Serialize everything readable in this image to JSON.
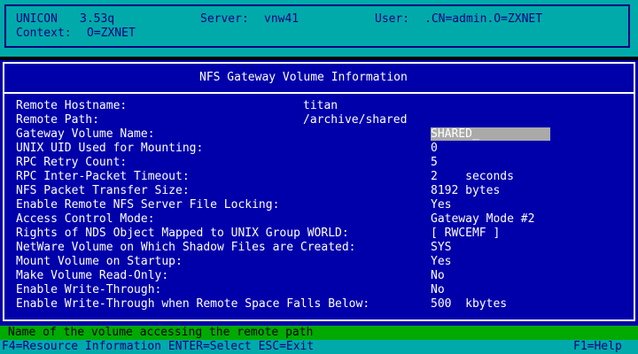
{
  "header": {
    "app_name": "UNICON",
    "version": "3.53q",
    "server_label": "Server:",
    "server_value": "vnw41",
    "user_label": "User:",
    "user_value": ".CN=admin.O=ZXNET",
    "context_label": "Context:",
    "context_value": "O=ZXNET"
  },
  "panel": {
    "title": "NFS Gateway Volume Information",
    "fields": [
      {
        "label": "Remote Hostname:",
        "value": "titan"
      },
      {
        "label": "Remote Path:",
        "value": "/archive/shared"
      },
      {
        "label": "Gateway Volume Name:",
        "value": "SHARED_"
      },
      {
        "label": "UNIX UID Used for Mounting:",
        "value": "0"
      },
      {
        "label": "RPC Retry Count:",
        "value": "5"
      },
      {
        "label": "RPC Inter-Packet Timeout:",
        "value": "2    seconds"
      },
      {
        "label": "NFS Packet Transfer Size:",
        "value": "8192 bytes"
      },
      {
        "label": "Enable Remote NFS Server File Locking:",
        "value": "Yes"
      },
      {
        "label": "Access Control Mode:",
        "value": "Gateway Mode #2"
      },
      {
        "label": "Rights of NDS Object Mapped to UNIX Group WORLD:",
        "value": "[ RWCEMF ]"
      },
      {
        "label": "NetWare Volume on Which Shadow Files are Created:",
        "value": "SYS"
      },
      {
        "label": "Mount Volume on Startup:",
        "value": "Yes"
      },
      {
        "label": "Make Volume Read-Only:",
        "value": "No"
      },
      {
        "label": "Enable Write-Through:",
        "value": "No"
      },
      {
        "label": "Enable Write-Through when Remote Space Falls Below:",
        "value": "500  kbytes"
      }
    ]
  },
  "help_text": "Name of the volume accessing the remote path",
  "key_help": {
    "left": "F4=Resource Information ENTER=Select ESC=Exit",
    "right": "F1=Help"
  },
  "colors": {
    "header_bg": "#00aaaa",
    "panel_bg": "#0000aa",
    "help_bg": "#00aa00",
    "field_highlight": "#aaaaaa"
  }
}
